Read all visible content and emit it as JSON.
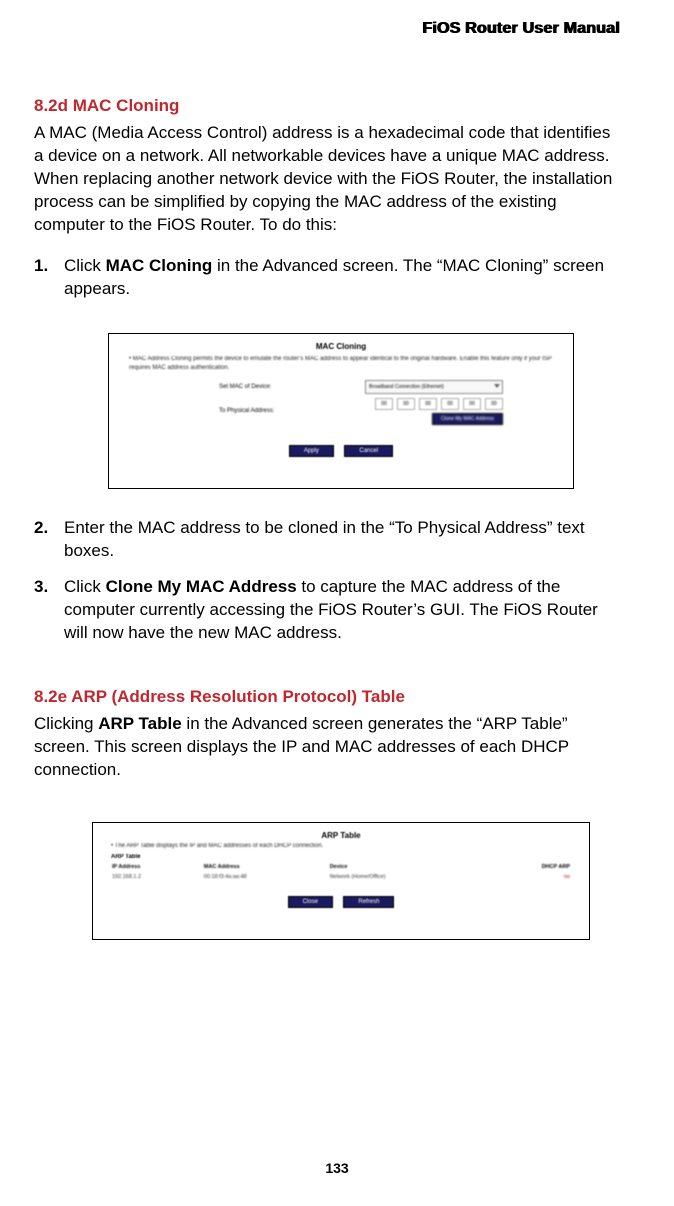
{
  "header": {
    "title": "FiOS Router User Manual"
  },
  "section1": {
    "heading": "8.2d  MAC Cloning",
    "intro": "A MAC (Media Access Control) address is a hexadecimal code that identifies a device on a network. All networkable devices have a unique MAC address. When replacing another network device with the FiOS Router, the installation process can be simplified by copying the MAC address of the existing computer to the FiOS Router. To do this:",
    "steps": [
      {
        "num": "1.",
        "pre": "Click ",
        "bold": "MAC Cloning",
        "post": " in the Advanced screen. The “MAC Cloning” screen appears."
      },
      {
        "num": "2.",
        "pre": "Enter the MAC address to be cloned in the “To Physical Address” text boxes.",
        "bold": "",
        "post": ""
      },
      {
        "num": "3.",
        "pre": "Click ",
        "bold": "Clone My MAC Address",
        "post": " to capture the MAC address of the computer currently accessing the FiOS Router’s GUI. The FiOS Router will now have the new MAC address."
      }
    ]
  },
  "fig1": {
    "title": "MAC Cloning",
    "note": "MAC Address Cloning permits the device to emulate the router’s MAC address to appear identical to the original hardware. Enable this feature only if your ISP requires MAC address authentication.",
    "row1_label": "Set MAC of Device:",
    "row1_value": "Broadband Connection (Ethernet)",
    "row2_label": "To Physical Address:",
    "mac": [
      "00",
      "00",
      "00",
      "00",
      "00",
      "00"
    ],
    "clone_btn": "Clone My MAC Address",
    "apply": "Apply",
    "cancel": "Cancel"
  },
  "section2": {
    "heading": "8.2e  ARP (Address Resolution Protocol) Table",
    "intro_pre": "Clicking ",
    "intro_bold": "ARP Table",
    "intro_post": " in the Advanced screen generates the “ARP Table” screen. This screen displays the IP and MAC addresses of each DHCP connection."
  },
  "fig2": {
    "title": "ARP Table",
    "note": "The ARP Table displays the IP and MAC addresses of each DHCP connection.",
    "label": "ARP Table",
    "headers": [
      "IP Address",
      "MAC Address",
      "Device",
      "DHCP ARP"
    ],
    "row": [
      "192.168.1.2",
      "00:18:f3:4a:aa:48",
      "Network (Home/Office)",
      "no"
    ],
    "close": "Close",
    "refresh": "Refresh"
  },
  "page_number": "133"
}
